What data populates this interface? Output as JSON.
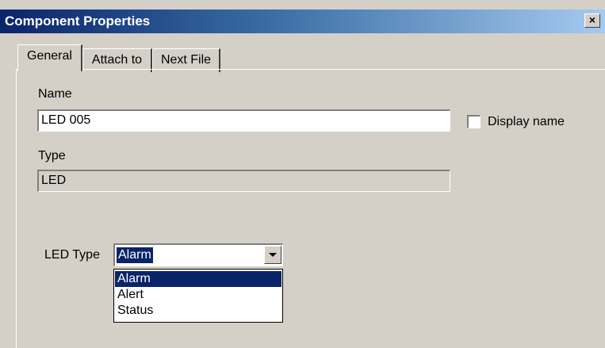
{
  "window": {
    "title": "Component Properties",
    "close_label": "×"
  },
  "tabs": [
    {
      "label": "General"
    },
    {
      "label": "Attach to"
    },
    {
      "label": "Next File"
    }
  ],
  "general": {
    "name_label": "Name",
    "name_value": "LED 005",
    "display_name_label": "Display name",
    "display_name_checked": false,
    "type_label": "Type",
    "type_value": "LED",
    "led_type_label": "LED Type",
    "led_type_value": "Alarm",
    "led_type_options": [
      "Alarm",
      "Alert",
      "Status"
    ]
  },
  "colors": {
    "face": "#d4d0c8",
    "titlebar_start": "#0a246a",
    "titlebar_end": "#a6caf0",
    "selection": "#0a246a"
  }
}
